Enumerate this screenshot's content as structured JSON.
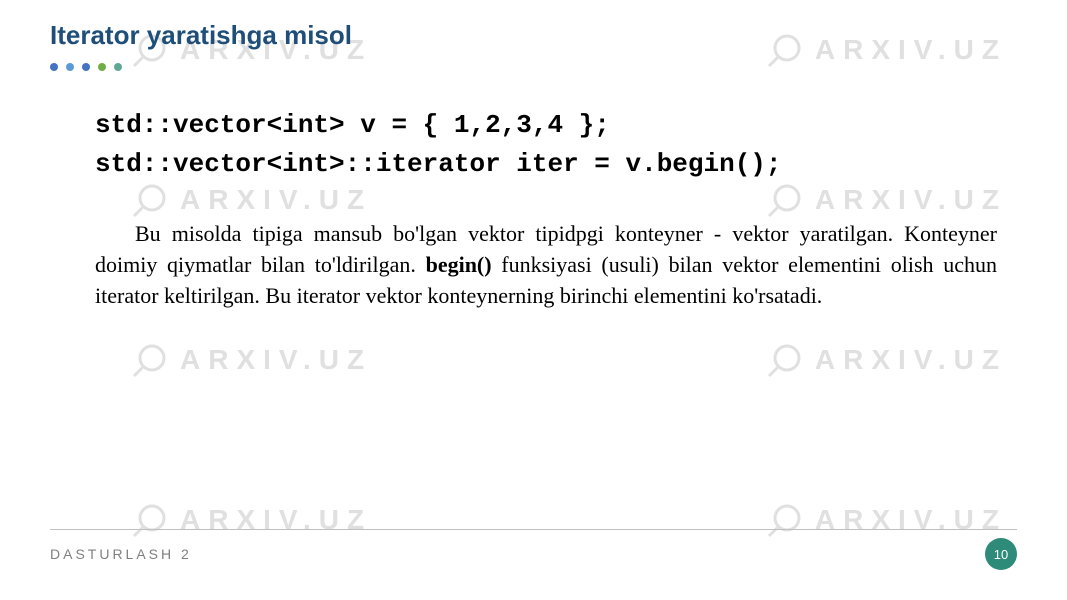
{
  "watermark": {
    "text": "ARXIV.UZ"
  },
  "title": "Iterator yaratishga misol",
  "code": {
    "line1": "std::vector<int> v = { 1,2,3,4 };",
    "line2": "std::vector<int>::iterator iter = v.begin();"
  },
  "paragraph": {
    "part1": "Bu misolda tipiga mansub bo'lgan vektor tipidpgi konteyner - vektor yaratilgan. Konteyner doimiy qiymatlar bilan to'ldirilgan. ",
    "bold": "begin()",
    "part2": " funksiyasi (usuli) bilan vektor elementini olish uchun iterator keltirilgan.  Bu iterator vektor konteynerning birinchi elementini ko'rsatadi."
  },
  "footer": {
    "text": "DASTURLASH 2",
    "page": "10"
  }
}
